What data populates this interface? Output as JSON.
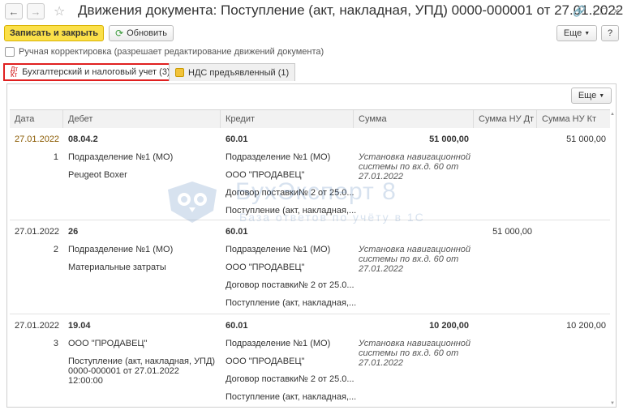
{
  "window": {
    "title": "Движения документа: Поступление (акт, накладная, УПД) 0000-000001 от 27.01.2022...",
    "back_icon": "arrow-left-icon",
    "forward_icon": "arrow-right-icon",
    "favorite_icon": "star-icon",
    "link_icon": "link-icon",
    "menu_icon": "more-vertical-icon",
    "maximize_icon": "maximize-icon",
    "close_icon": "close-icon"
  },
  "toolbar": {
    "save_close_label": "Записать и закрыть",
    "refresh_label": "Обновить",
    "more_label": "Еще",
    "help_label": "?"
  },
  "manual_correction": {
    "label": "Ручная корректировка (разрешает редактирование движений документа)",
    "checked": false
  },
  "tabs": [
    {
      "label": "Бухгалтерский и налоговый учет (3)",
      "icon": "Дт Кт",
      "active": true
    },
    {
      "label": "НДС предъявленный (1)",
      "icon": "vat-icon",
      "active": false
    }
  ],
  "grid": {
    "more_label": "Еще",
    "columns": [
      "Дата",
      "Дебет",
      "Кредит",
      "Сумма",
      "Сумма НУ Дт",
      "Сумма НУ Кт"
    ],
    "rows": [
      {
        "date": "27.01.2022",
        "num": "1",
        "debit": [
          "08.04.2",
          "Подразделение №1 (МО)",
          "Peugeot Boxer"
        ],
        "credit": [
          "60.01",
          "Подразделение №1 (МО)",
          "ООО \"ПРОДАВЕЦ\"",
          "Договор поставки№ 2 от 25.0...",
          "Поступление (акт, накладная,..."
        ],
        "sum": "51 000,00",
        "content": "Установка навигационной системы по вх.д. 60 от 27.01.2022",
        "nu_dt": "",
        "nu_kt": "51 000,00"
      },
      {
        "date": "27.01.2022",
        "num": "2",
        "debit": [
          "26",
          "Подразделение №1 (МО)",
          "Материальные затраты"
        ],
        "credit": [
          "60.01",
          "Подразделение №1 (МО)",
          "ООО \"ПРОДАВЕЦ\"",
          "Договор поставки№ 2 от 25.0...",
          "Поступление (акт, накладная,..."
        ],
        "sum": "",
        "content": "Установка навигационной системы по вх.д. 60 от 27.01.2022",
        "nu_dt": "51 000,00",
        "nu_kt": ""
      },
      {
        "date": "27.01.2022",
        "num": "3",
        "debit": [
          "19.04",
          "ООО \"ПРОДАВЕЦ\"",
          "Поступление (акт, накладная, УПД) 0000-000001 от 27.01.2022 12:00:00"
        ],
        "credit": [
          "60.01",
          "Подразделение №1 (МО)",
          "ООО \"ПРОДАВЕЦ\"",
          "Договор поставки№ 2 от 25.0...",
          "Поступление (акт, накладная,..."
        ],
        "sum": "10 200,00",
        "content": "Установка навигационной системы по вх.д. 60 от 27.01.2022",
        "nu_dt": "",
        "nu_kt": "10 200,00"
      }
    ]
  },
  "watermark": {
    "brand": "БухЭксперт 8",
    "tagline": "База ответов по учёту в 1С"
  },
  "colors": {
    "primary_button": "#fbe049",
    "active_tab_border": "#e02020",
    "watermark": "#2a63a8"
  }
}
